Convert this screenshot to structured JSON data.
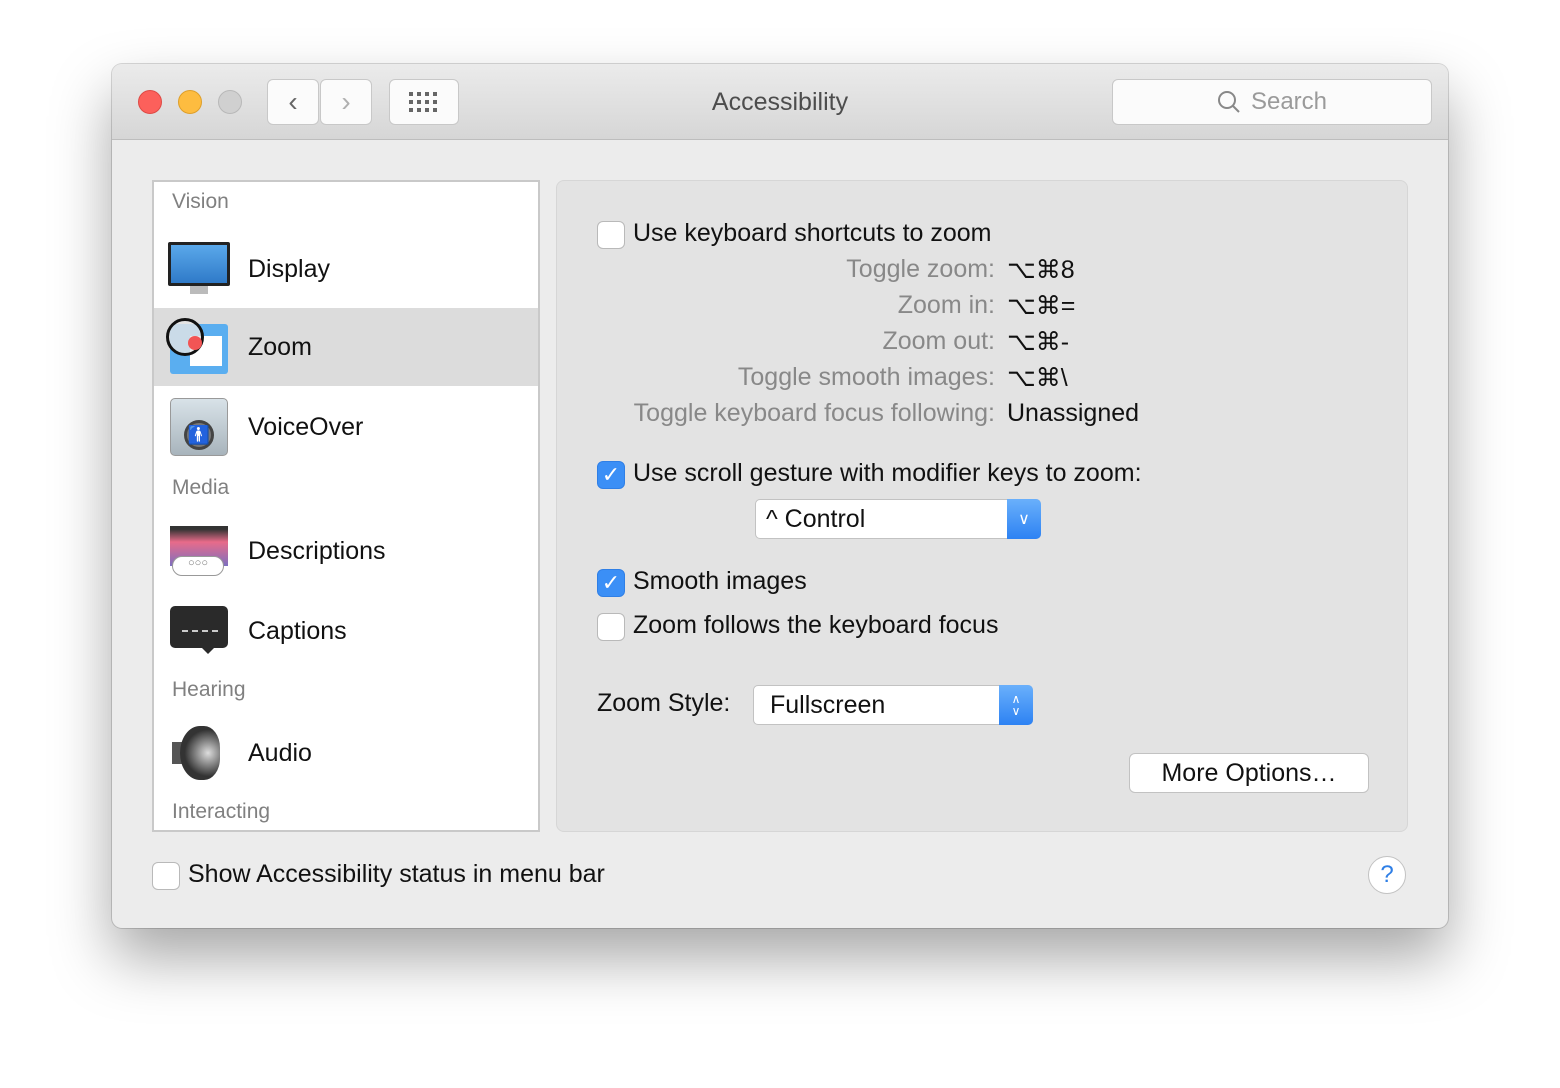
{
  "window": {
    "title": "Accessibility",
    "search_placeholder": "Search"
  },
  "sidebar": {
    "sections": [
      "Vision",
      "Media",
      "Hearing",
      "Interacting"
    ],
    "items": [
      {
        "label": "Display",
        "icon": "display-icon"
      },
      {
        "label": "Zoom",
        "icon": "zoom-icon",
        "selected": true
      },
      {
        "label": "VoiceOver",
        "icon": "voiceover-icon"
      },
      {
        "label": "Descriptions",
        "icon": "descriptions-icon"
      },
      {
        "label": "Captions",
        "icon": "captions-icon"
      },
      {
        "label": "Audio",
        "icon": "audio-icon"
      }
    ]
  },
  "zoom": {
    "keyboard_shortcuts": {
      "label": "Use keyboard shortcuts to zoom",
      "checked": false
    },
    "shortcuts": [
      {
        "label": "Toggle zoom:",
        "keys": "⌥⌘8"
      },
      {
        "label": "Zoom in:",
        "keys": "⌥⌘="
      },
      {
        "label": "Zoom out:",
        "keys": "⌥⌘-"
      },
      {
        "label": "Toggle smooth images:",
        "keys": "⌥⌘\\"
      },
      {
        "label": "Toggle keyboard focus following:",
        "keys": "Unassigned"
      }
    ],
    "scroll_gesture": {
      "label": "Use scroll gesture with modifier keys to zoom:",
      "checked": true,
      "modifier": "^ Control"
    },
    "smooth_images": {
      "label": "Smooth images",
      "checked": true
    },
    "follows_focus": {
      "label": "Zoom follows the keyboard focus",
      "checked": false
    },
    "zoom_style": {
      "label": "Zoom Style:",
      "value": "Fullscreen"
    },
    "more_options": "More Options…"
  },
  "footer": {
    "status_label": "Show Accessibility status in menu bar",
    "checked": false,
    "help": "?"
  },
  "colors": {
    "accent": "#3b8ff6",
    "close": "#fc605b",
    "minimize": "#fdbc40"
  }
}
